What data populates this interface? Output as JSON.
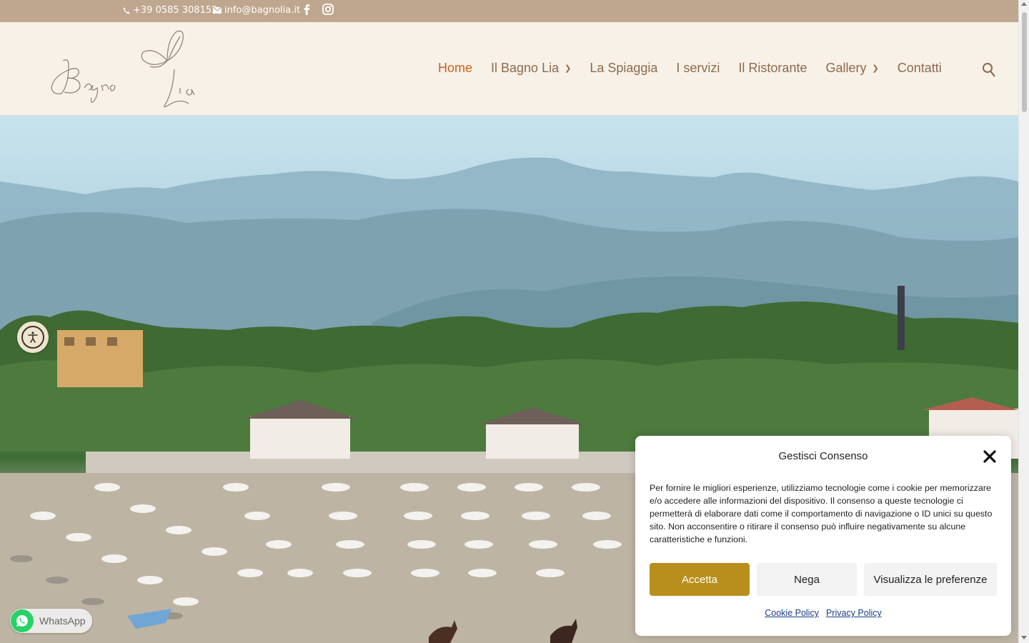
{
  "topbar": {
    "phone": "+39 0585 308155",
    "email": "info@bagnolia.it",
    "icons": [
      "phone-icon",
      "envelope-icon",
      "facebook-icon",
      "instagram-icon"
    ]
  },
  "header": {
    "logo_text": "Bagno Lia",
    "nav": [
      {
        "label": "Home",
        "active": true,
        "dropdown": false
      },
      {
        "label": "Il Bagno Lia",
        "active": false,
        "dropdown": true
      },
      {
        "label": "La Spiaggia",
        "active": false,
        "dropdown": false
      },
      {
        "label": "I servizi",
        "active": false,
        "dropdown": false
      },
      {
        "label": "Il Ristorante",
        "active": false,
        "dropdown": false
      },
      {
        "label": "Gallery",
        "active": false,
        "dropdown": true
      },
      {
        "label": "Contatti",
        "active": false,
        "dropdown": false
      }
    ]
  },
  "whatsapp": {
    "label": "WhatsApp"
  },
  "consent": {
    "title": "Gestisci Consenso",
    "body": "Per fornire le migliori esperienze, utilizziamo tecnologie come i cookie per memorizzare e/o accedere alle informazioni del dispositivo. Il consenso a queste tecnologie ci permetterà di elaborare dati come il comportamento di navigazione o ID unici su questo sito. Non acconsentire o ritirare il consenso può influire negativamente su alcune caratteristiche e funzioni.",
    "accept_label": "Accetta",
    "deny_label": "Nega",
    "prefs_label": "Visualizza le preferenze",
    "cookie_policy": "Cookie Policy",
    "privacy_policy": "Privacy Policy"
  },
  "colors": {
    "topbar": "#bfa68e",
    "header_bg": "#f8f1e7",
    "nav_text": "#8d6a4e",
    "nav_active": "#c9631b",
    "accept_button": "#b88f1c",
    "whatsapp_green": "#25d366"
  }
}
